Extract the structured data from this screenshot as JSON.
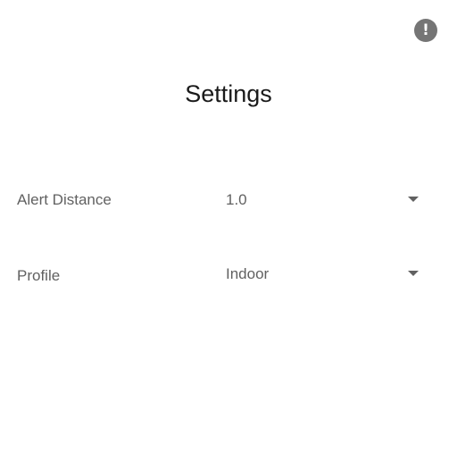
{
  "header": {
    "title": "Settings",
    "info_icon": "exclamation-circle-icon",
    "info_glyph": "!"
  },
  "settings": {
    "alert_distance": {
      "label": "Alert Distance",
      "value": "1.0"
    },
    "profile": {
      "label": "Profile",
      "value": "Indoor"
    }
  },
  "colors": {
    "icon_background": "#757575",
    "text_primary": "#1a1a1a",
    "text_secondary": "#616161"
  }
}
